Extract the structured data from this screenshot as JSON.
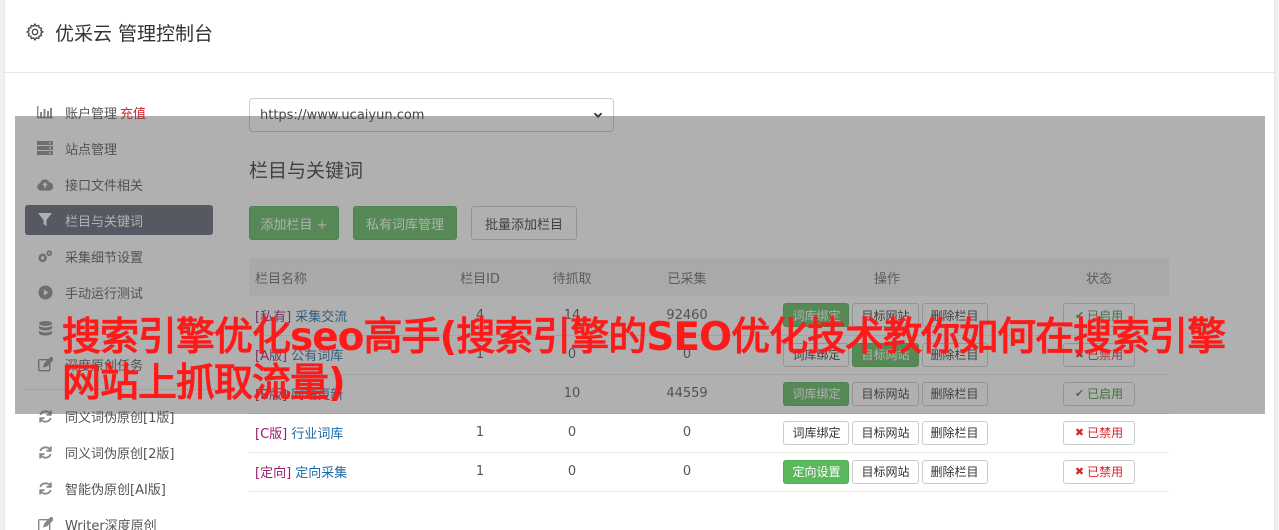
{
  "header": {
    "title": "优采云 管理控制台"
  },
  "sidebar": {
    "items": [
      {
        "label": "账户管理",
        "extra": "充值",
        "icon": "bar-chart-icon"
      },
      {
        "label": "站点管理",
        "icon": "server-icon"
      },
      {
        "label": "接口文件相关",
        "icon": "cloud-upload-icon"
      },
      {
        "label": "栏目与关键词",
        "icon": "filter-icon",
        "active": true
      },
      {
        "label": "采集细节设置",
        "icon": "gears-icon"
      },
      {
        "label": "手动运行测试",
        "icon": "play-circle-icon"
      },
      {
        "label": "",
        "icon": "database-icon"
      },
      {
        "label": "深度原创任务",
        "icon": "edit-icon"
      }
    ],
    "items2": [
      {
        "label": "同义词伪原创[1版]",
        "icon": "refresh-icon"
      },
      {
        "label": "同义词伪原创[2版]",
        "icon": "refresh-icon"
      },
      {
        "label": "智能伪原创[AI版]",
        "icon": "refresh-icon"
      },
      {
        "label": "Writer深度原创",
        "icon": "edit-icon"
      }
    ]
  },
  "main": {
    "site_select": "https://www.ucaiyun.com",
    "section_title": "栏目与关键词",
    "buttons": {
      "add_column": "添加栏目 +",
      "private_lexicon": "私有词库管理",
      "batch_add": "批量添加栏目"
    },
    "table": {
      "headers": [
        "栏目名称",
        "栏目ID",
        "待抓取",
        "已采集",
        "操作",
        "状态"
      ],
      "rows": [
        {
          "tag": "[私有]",
          "name": "采集交流",
          "id": "4",
          "pending": "14",
          "collected": "92460",
          "ops": [
            "词库绑定",
            "目标网站",
            "删除栏目"
          ],
          "op_green": [
            0
          ],
          "status": "已启用",
          "status_on": true
        },
        {
          "tag": "[A版]",
          "name": "公有词库",
          "id": "1",
          "pending": "0",
          "collected": "0",
          "ops": [
            "词库绑定",
            "目标网站",
            "删除栏目"
          ],
          "op_green": [
            1
          ],
          "status": "已禁用",
          "status_on": false
        },
        {
          "tag": "[B版]",
          "name": "网站更新",
          "id": "",
          "pending": "10",
          "collected": "44559",
          "ops": [
            "词库绑定",
            "目标网站",
            "删除栏目"
          ],
          "op_green": [
            0
          ],
          "status": "已启用",
          "status_on": true
        },
        {
          "tag": "[C版]",
          "name": "行业词库",
          "id": "1",
          "pending": "0",
          "collected": "0",
          "ops": [
            "词库绑定",
            "目标网站",
            "删除栏目"
          ],
          "op_green": [],
          "status": "已禁用",
          "status_on": false
        },
        {
          "tag": "[定向]",
          "name": "定向采集",
          "id": "1",
          "pending": "0",
          "collected": "0",
          "ops": [
            "定向设置",
            "目标网站",
            "删除栏目"
          ],
          "op_green": [
            0
          ],
          "status": "已禁用",
          "status_on": false
        }
      ]
    }
  },
  "overlay": {
    "headline": "搜索引擎优化seo高手(搜索引擎的SEO优化技术教你如何在搜索引擎网站上抓取流量)"
  }
}
